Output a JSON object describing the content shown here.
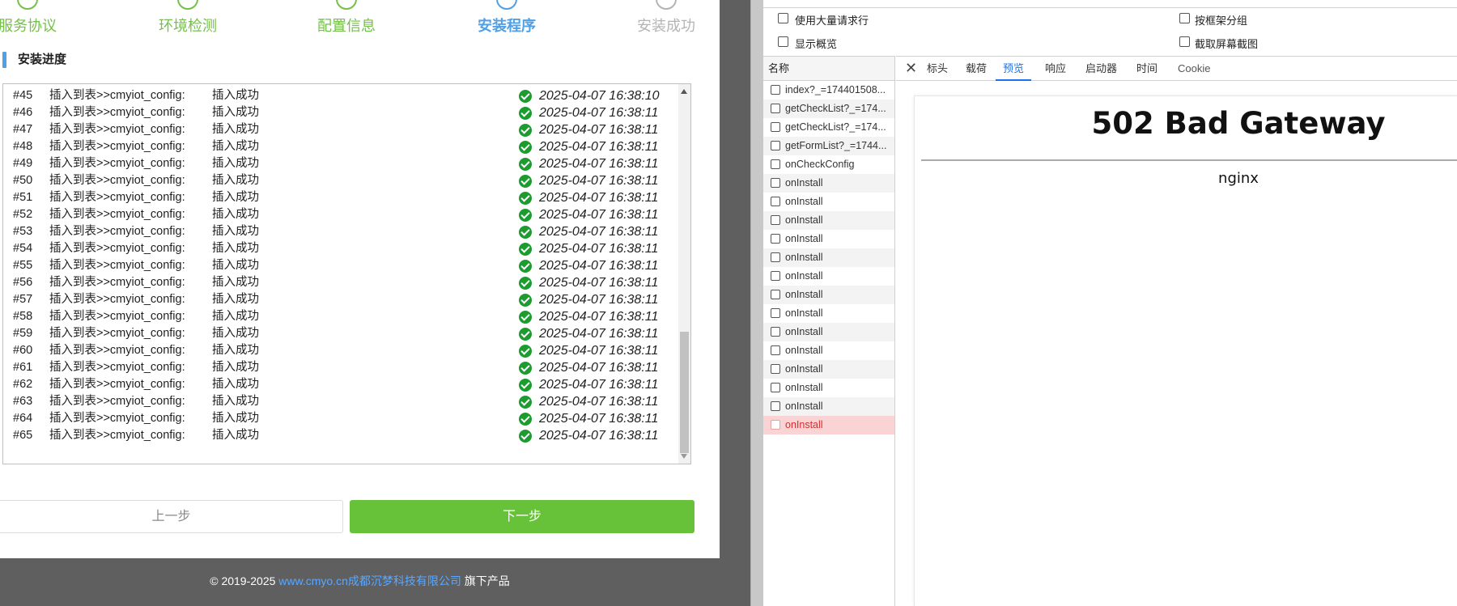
{
  "installer": {
    "steps": [
      {
        "label": "服务协议",
        "state": "done"
      },
      {
        "label": "环境检测",
        "state": "done"
      },
      {
        "label": "配置信息",
        "state": "done"
      },
      {
        "label": "安装程序",
        "state": "active"
      },
      {
        "label": "安装成功",
        "state": "pending"
      }
    ],
    "section_title": "安装进度",
    "log_rows": [
      {
        "num": "#45",
        "msg": "插入到表>>cmyiot_config:",
        "status": "插入成功",
        "time": "2025-04-07 16:38:10"
      },
      {
        "num": "#46",
        "msg": "插入到表>>cmyiot_config:",
        "status": "插入成功",
        "time": "2025-04-07 16:38:11"
      },
      {
        "num": "#47",
        "msg": "插入到表>>cmyiot_config:",
        "status": "插入成功",
        "time": "2025-04-07 16:38:11"
      },
      {
        "num": "#48",
        "msg": "插入到表>>cmyiot_config:",
        "status": "插入成功",
        "time": "2025-04-07 16:38:11"
      },
      {
        "num": "#49",
        "msg": "插入到表>>cmyiot_config:",
        "status": "插入成功",
        "time": "2025-04-07 16:38:11"
      },
      {
        "num": "#50",
        "msg": "插入到表>>cmyiot_config:",
        "status": "插入成功",
        "time": "2025-04-07 16:38:11"
      },
      {
        "num": "#51",
        "msg": "插入到表>>cmyiot_config:",
        "status": "插入成功",
        "time": "2025-04-07 16:38:11"
      },
      {
        "num": "#52",
        "msg": "插入到表>>cmyiot_config:",
        "status": "插入成功",
        "time": "2025-04-07 16:38:11"
      },
      {
        "num": "#53",
        "msg": "插入到表>>cmyiot_config:",
        "status": "插入成功",
        "time": "2025-04-07 16:38:11"
      },
      {
        "num": "#54",
        "msg": "插入到表>>cmyiot_config:",
        "status": "插入成功",
        "time": "2025-04-07 16:38:11"
      },
      {
        "num": "#55",
        "msg": "插入到表>>cmyiot_config:",
        "status": "插入成功",
        "time": "2025-04-07 16:38:11"
      },
      {
        "num": "#56",
        "msg": "插入到表>>cmyiot_config:",
        "status": "插入成功",
        "time": "2025-04-07 16:38:11"
      },
      {
        "num": "#57",
        "msg": "插入到表>>cmyiot_config:",
        "status": "插入成功",
        "time": "2025-04-07 16:38:11"
      },
      {
        "num": "#58",
        "msg": "插入到表>>cmyiot_config:",
        "status": "插入成功",
        "time": "2025-04-07 16:38:11"
      },
      {
        "num": "#59",
        "msg": "插入到表>>cmyiot_config:",
        "status": "插入成功",
        "time": "2025-04-07 16:38:11"
      },
      {
        "num": "#60",
        "msg": "插入到表>>cmyiot_config:",
        "status": "插入成功",
        "time": "2025-04-07 16:38:11"
      },
      {
        "num": "#61",
        "msg": "插入到表>>cmyiot_config:",
        "status": "插入成功",
        "time": "2025-04-07 16:38:11"
      },
      {
        "num": "#62",
        "msg": "插入到表>>cmyiot_config:",
        "status": "插入成功",
        "time": "2025-04-07 16:38:11"
      },
      {
        "num": "#63",
        "msg": "插入到表>>cmyiot_config:",
        "status": "插入成功",
        "time": "2025-04-07 16:38:11"
      },
      {
        "num": "#64",
        "msg": "插入到表>>cmyiot_config:",
        "status": "插入成功",
        "time": "2025-04-07 16:38:11"
      },
      {
        "num": "#65",
        "msg": "插入到表>>cmyiot_config:",
        "status": "插入成功",
        "time": "2025-04-07 16:38:11"
      }
    ],
    "prev_label": "上一步",
    "next_label": "下一步",
    "footer": {
      "copyright": "© 2019-2025",
      "link_text": "www.cmyo.cn成都沉梦科技有限公司",
      "suffix": "旗下产品"
    },
    "colors": {
      "done": "#74c04a",
      "active": "#4fa0e6",
      "pending": "#b4b4b4",
      "next_button": "#67c23a",
      "check": "#1c9b2f"
    }
  },
  "devtools": {
    "options": [
      {
        "label": "使用大量请求行",
        "checked": false
      },
      {
        "label": "显示概览",
        "checked": false
      },
      {
        "label": "按框架分组",
        "checked": false
      },
      {
        "label": "截取屏幕截图",
        "checked": false
      }
    ],
    "name_header": "名称",
    "requests": [
      {
        "name": "index?_=174401508...",
        "error": false
      },
      {
        "name": "getCheckList?_=174...",
        "error": false
      },
      {
        "name": "getCheckList?_=174...",
        "error": false
      },
      {
        "name": "getFormList?_=1744...",
        "error": false
      },
      {
        "name": "onCheckConfig",
        "error": false
      },
      {
        "name": "onInstall",
        "error": false
      },
      {
        "name": "onInstall",
        "error": false
      },
      {
        "name": "onInstall",
        "error": false
      },
      {
        "name": "onInstall",
        "error": false
      },
      {
        "name": "onInstall",
        "error": false
      },
      {
        "name": "onInstall",
        "error": false
      },
      {
        "name": "onInstall",
        "error": false
      },
      {
        "name": "onInstall",
        "error": false
      },
      {
        "name": "onInstall",
        "error": false
      },
      {
        "name": "onInstall",
        "error": false
      },
      {
        "name": "onInstall",
        "error": false
      },
      {
        "name": "onInstall",
        "error": false
      },
      {
        "name": "onInstall",
        "error": false
      },
      {
        "name": "onInstall",
        "error": true
      }
    ],
    "close_glyph": "✕",
    "tabs": [
      {
        "label": "标头",
        "active": false
      },
      {
        "label": "载荷",
        "active": false
      },
      {
        "label": "预览",
        "active": true
      },
      {
        "label": "响应",
        "active": false
      },
      {
        "label": "启动器",
        "active": false
      },
      {
        "label": "时间",
        "active": false
      },
      {
        "label": "Cookie",
        "active": false
      }
    ],
    "preview": {
      "title": "502 Bad Gateway",
      "server": "nginx"
    }
  }
}
